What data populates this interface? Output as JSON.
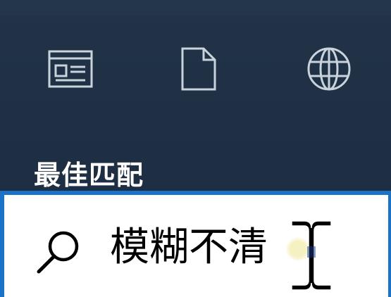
{
  "filters": {
    "items": [
      {
        "name": "apps",
        "icon": "app-window-icon"
      },
      {
        "name": "documents",
        "icon": "document-icon"
      },
      {
        "name": "web",
        "icon": "globe-icon"
      }
    ]
  },
  "results": {
    "best_match_heading": "最佳匹配"
  },
  "search": {
    "query": "模糊不清"
  },
  "colors": {
    "panel_background": "#1f3045",
    "search_border": "#1a73c9",
    "icon_stroke": "#c9d3dc"
  }
}
